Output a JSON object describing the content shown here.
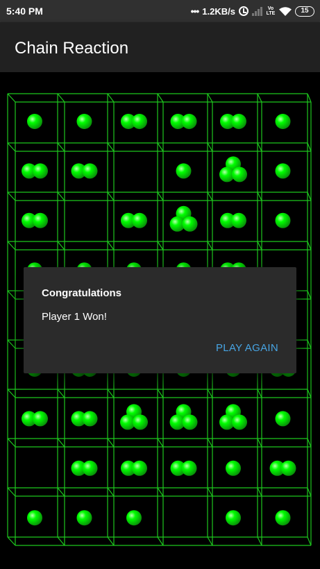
{
  "status_bar": {
    "time": "5:40 PM",
    "network_speed": "1.2KB/s",
    "volte": "Vo LTE",
    "battery": "15",
    "icons": [
      "dots-icon",
      "alarm-icon",
      "signal-icon",
      "volte-icon",
      "wifi-icon",
      "battery-icon"
    ]
  },
  "app_bar": {
    "title": "Chain Reaction"
  },
  "board": {
    "rows": 9,
    "cols": 6,
    "player_color": "#00ff00",
    "grid_color": "#1ec81e",
    "cells": [
      [
        1,
        1,
        2,
        2,
        2,
        1
      ],
      [
        2,
        2,
        0,
        1,
        3,
        1
      ],
      [
        2,
        0,
        2,
        3,
        2,
        1
      ],
      [
        1,
        1,
        1,
        1,
        2,
        0
      ],
      [
        0,
        0,
        0,
        0,
        0,
        0
      ],
      [
        1,
        2,
        1,
        1,
        1,
        2
      ],
      [
        2,
        2,
        3,
        3,
        3,
        1
      ],
      [
        0,
        2,
        2,
        2,
        1,
        2
      ],
      [
        1,
        1,
        1,
        0,
        1,
        1
      ]
    ]
  },
  "dialog": {
    "title": "Congratulations",
    "message": "Player 1 Won!",
    "button_label": "PLAY AGAIN"
  }
}
